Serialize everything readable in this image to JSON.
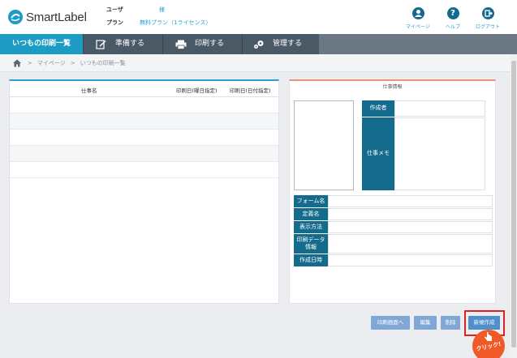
{
  "header": {
    "logo": "SmartLabel",
    "user_label": "ユーザ",
    "user_value": "様",
    "plan_label": "プラン",
    "plan_value": "無料プラン（1ライセンス）",
    "buttons": [
      {
        "label": "マイページ",
        "icon": "user-icon"
      },
      {
        "label": "ヘルプ",
        "icon": "help-icon"
      },
      {
        "label": "ログアウト",
        "icon": "logout-icon"
      }
    ]
  },
  "nav": {
    "items": [
      {
        "label": "いつもの印刷一覧",
        "icon": "",
        "active": true
      },
      {
        "label": "準備する",
        "icon": "edit-icon",
        "active": false
      },
      {
        "label": "印刷する",
        "icon": "printer-icon",
        "active": false
      },
      {
        "label": "管理する",
        "icon": "gear-icon",
        "active": false
      }
    ]
  },
  "breadcrumb": {
    "home_icon": "home-icon",
    "sep": ">",
    "items": [
      "マイページ",
      "いつもの印刷一覧"
    ]
  },
  "list": {
    "columns": [
      "仕事名",
      "印刷日(曜日指定)",
      "印刷日(日付指定)"
    ],
    "rows": []
  },
  "detail": {
    "title": "仕事情報",
    "creator_label": "作成者",
    "memo_label": "仕事メモ",
    "fields": [
      {
        "label": "フォーム名",
        "value": ""
      },
      {
        "label": "定義名",
        "value": ""
      },
      {
        "label": "表示方法",
        "value": ""
      },
      {
        "label": "印刷データ\n情報",
        "value": ""
      },
      {
        "label": "作成日時",
        "value": ""
      }
    ]
  },
  "actions": {
    "print_screen": "印刷画面へ",
    "edit": "編集",
    "delete": "削除",
    "new": "新規作成",
    "click_badge": "クリック!"
  },
  "colors": {
    "accent": "#1c9bc4",
    "nav_bg": "#4a5966",
    "label_bg": "#156b8c",
    "button": "#4f8fcc",
    "highlight": "#e02020",
    "badge": "#f05a28"
  }
}
